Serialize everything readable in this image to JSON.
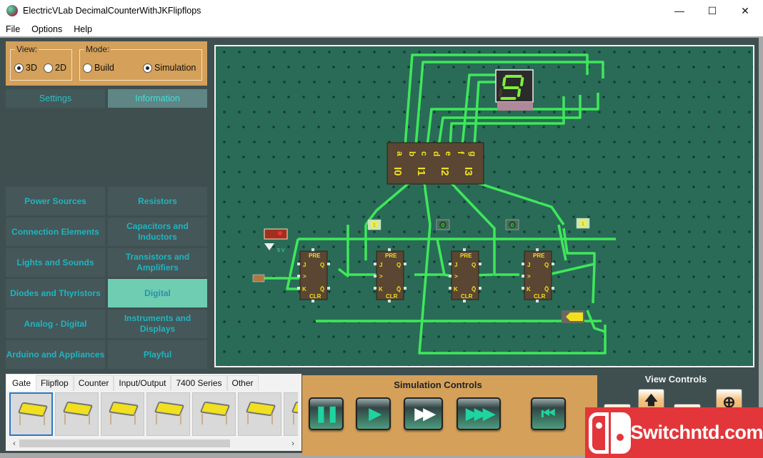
{
  "window": {
    "title": "ElectricVLab  DecimalCounterWithJKFlipflops",
    "controls": {
      "minimize": "—",
      "maximize": "☐",
      "close": "✕"
    }
  },
  "menu": [
    "File",
    "Options",
    "Help"
  ],
  "view_group": {
    "legend": "View:",
    "options": [
      {
        "label": "3D",
        "selected": true
      },
      {
        "label": "2D",
        "selected": false
      }
    ]
  },
  "mode_group": {
    "legend": "Mode:",
    "options": [
      {
        "label": "Build",
        "selected": false
      },
      {
        "label": "Simulation",
        "selected": true
      }
    ]
  },
  "panel_tabs": [
    {
      "label": "Settings",
      "active": false
    },
    {
      "label": "Information",
      "active": true
    }
  ],
  "categories": [
    {
      "label": "Power Sources",
      "active": false
    },
    {
      "label": "Resistors",
      "active": false
    },
    {
      "label": "Connection Elements",
      "active": false
    },
    {
      "label": "Capacitors and Inductors",
      "active": false
    },
    {
      "label": "Lights and Sounds",
      "active": false
    },
    {
      "label": "Transistors and Amplifiers",
      "active": false
    },
    {
      "label": "Diodes and Thyristors",
      "active": false
    },
    {
      "label": "Digital",
      "active": true
    },
    {
      "label": "Analog - Digital",
      "active": false
    },
    {
      "label": "Instruments and Displays",
      "active": false
    },
    {
      "label": "Arduino and Appliances",
      "active": false
    },
    {
      "label": "Playful",
      "active": false
    }
  ],
  "tray": {
    "tabs": [
      {
        "label": "Gate",
        "active": true
      },
      {
        "label": "Flipflop",
        "active": false
      },
      {
        "label": "Counter",
        "active": false
      },
      {
        "label": "Input/Output",
        "active": false
      },
      {
        "label": "7400 Series",
        "active": false
      },
      {
        "label": "Other",
        "active": false
      }
    ],
    "item_count_visible": 7,
    "selected_index": 0,
    "scroll_left": "‹",
    "scroll_right": "›"
  },
  "simulation_controls": {
    "title": "Simulation Controls",
    "buttons": [
      {
        "name": "pause",
        "glyph": "❚❚"
      },
      {
        "name": "play",
        "glyph": "▶"
      },
      {
        "name": "fast-forward",
        "glyph": "▶▶"
      },
      {
        "name": "fastest",
        "glyph": "▶▶▶"
      },
      {
        "name": "reset",
        "glyph": "⏮"
      }
    ]
  },
  "view_controls": {
    "title": "View Controls",
    "buttons": [
      {
        "name": "pan-up",
        "glyph": "🡅"
      },
      {
        "name": "zoom-in",
        "glyph": "⊕"
      }
    ]
  },
  "circuit": {
    "decoder_pin_labels_top": [
      "a",
      "b",
      "c",
      "d",
      "e",
      "f",
      "g"
    ],
    "decoder_pin_labels_bottom": [
      "I0",
      "I1",
      "I2",
      "I3"
    ],
    "seven_segment_value": "9",
    "source_label": "5 V",
    "led_states": [
      1,
      0,
      0,
      1
    ],
    "led_labels": [
      "1",
      "0",
      "0",
      "1"
    ],
    "flipflop_pins": {
      "pre": "PRE",
      "j": "J",
      "clk": ">",
      "k": "K",
      "q": "Q",
      "qbar": "Q̄",
      "clr": "CLR"
    },
    "flipflop_count": 4
  },
  "colors": {
    "board": "#2a6b57",
    "wire": "#3ee85a",
    "chip": "#5a4632",
    "chip_text": "#f0e020",
    "accent_panel": "#d4a05a",
    "category_active": "#6fcdb2"
  },
  "watermark": {
    "text": "Switchntd.com"
  }
}
